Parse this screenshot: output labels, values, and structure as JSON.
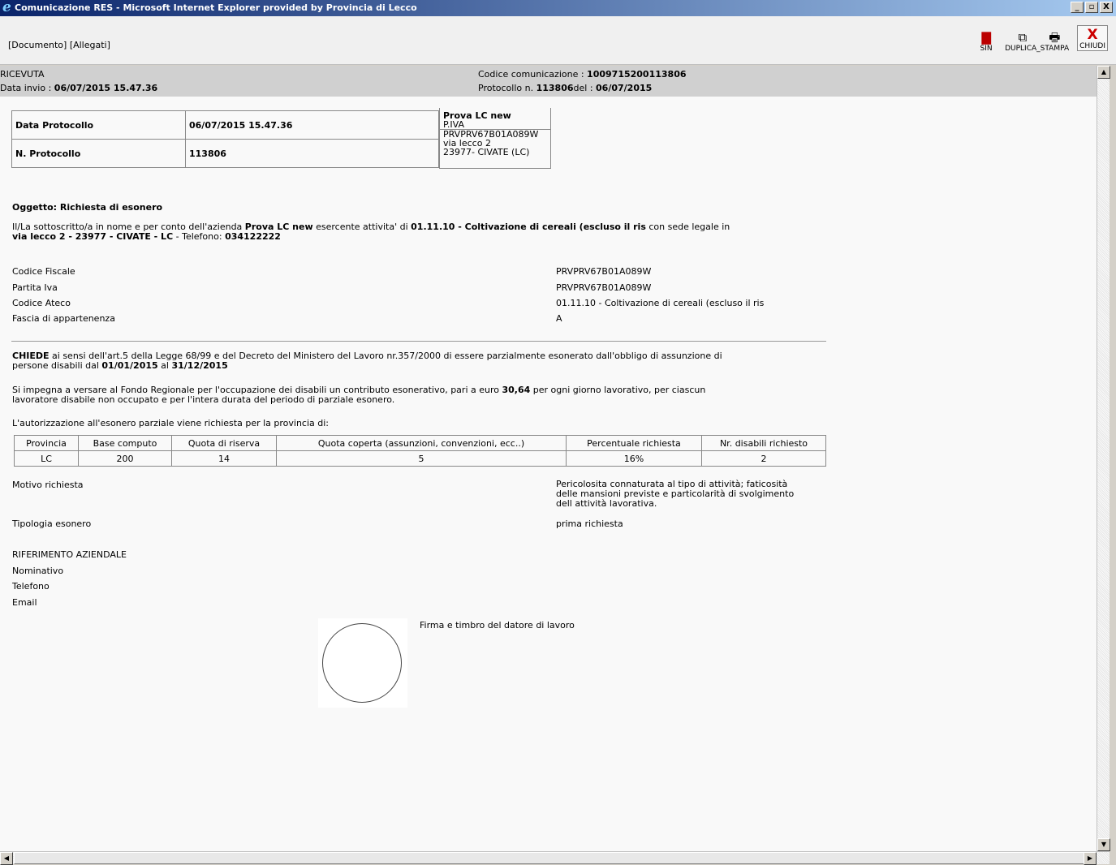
{
  "window": {
    "title": "Comunicazione RES - Microsoft Internet Explorer provided by Provincia di Lecco",
    "buttons": {
      "minimize": "_",
      "maximize": "▫",
      "close": "X"
    }
  },
  "toolbar": {
    "doc_link": "[Documento]",
    "allegati_link": "[Allegati]",
    "buttons": {
      "sin": "SIN",
      "duplica": "DUPLICA_",
      "stampa": "STAMPA",
      "chiudi": "CHIUDI"
    }
  },
  "header": {
    "type": "RICEVUTA",
    "data_invio_label": "Data invio : ",
    "data_invio": "06/07/2015 15.47.36",
    "codice_label": "Codice comunicazione : ",
    "codice": "1009715200113806",
    "protocollo_label": "Protocollo n. ",
    "protocollo": "113806",
    "del_label": "del : ",
    "del": "06/07/2015"
  },
  "protocol_table": {
    "row1_label": "Data Protocollo",
    "row1_value": "06/07/2015 15.47.36",
    "row2_label": "N. Protocollo",
    "row2_value": "113806"
  },
  "company": {
    "name": "Prova LC new",
    "piva_label": "P.IVA",
    "piva": "PRVPRV67B01A089W",
    "address": "via lecco 2",
    "city": "23977- CIVATE (LC)"
  },
  "oggetto": "Oggetto: Richiesta di esonero",
  "intro": {
    "p1": "Il/La sottoscritto/a in nome e per conto dell'azienda ",
    "company": "Prova LC new",
    "p2": " esercente attivita' di ",
    "ateco": "01.11.10 - Coltivazione di cereali (escluso il ris",
    "p3": " con sede legale in",
    "address": "via lecco 2 - 23977 - CIVATE - LC",
    "p4": " - Telefono: ",
    "phone": "034122222"
  },
  "details": [
    {
      "label": "Codice Fiscale",
      "value": "PRVPRV67B01A089W"
    },
    {
      "label": "Partita Iva",
      "value": "PRVPRV67B01A089W"
    },
    {
      "label": "Codice Ateco",
      "value": "01.11.10 - Coltivazione di cereali (escluso il ris"
    },
    {
      "label": "Fascia di appartenenza",
      "value": "A"
    }
  ],
  "chiede": {
    "bold": "CHIEDE",
    "t1": " ai sensi dell'art.5 della Legge 68/99 e del Decreto del Ministero del Lavoro nr.357/2000 di essere parzialmente esonerato dall'obbligo di assunzione di",
    "t2": "persone disabili dal ",
    "from": "01/01/2015",
    "t3": " al ",
    "to": "31/12/2015"
  },
  "impegna": {
    "t1": "Si impegna a versare al Fondo Regionale per l'occupazione dei disabili un contributo esonerativo, pari a euro ",
    "amount": "30,64",
    "t2": " per ogni giorno lavorativo, per ciascun",
    "t3": "lavoratore disabile non occupato e per l'intera durata del periodo di parziale esonero."
  },
  "autorizzazione": "L'autorizzazione all'esonero parziale viene richiesta per la provincia di:",
  "province_table": {
    "headers": [
      "Provincia",
      "Base computo",
      "Quota di riserva",
      "Quota coperta (assunzioni, convenzioni, ecc..)",
      "Percentuale richiesta",
      "Nr. disabili richiesto"
    ],
    "row": [
      "LC",
      "200",
      "14",
      "5",
      "16%",
      "2"
    ]
  },
  "motivo": {
    "label": "Motivo richiesta",
    "l1": "Pericolosita connaturata al tipo di attività; faticosità",
    "l2": "delle mansioni previste e particolarità di svolgimento",
    "l3": "dell attività lavorativa."
  },
  "tipologia": {
    "label": "Tipologia esonero",
    "value": "prima richiesta"
  },
  "riferimento": {
    "title": "RIFERIMENTO AZIENDALE",
    "nominativo": "Nominativo",
    "telefono": "Telefono",
    "email": "Email"
  },
  "firma": "Firma e timbro del datore di lavoro",
  "scroll": {
    "up": "▲",
    "down": "▼",
    "left": "◀",
    "right": "▶"
  }
}
